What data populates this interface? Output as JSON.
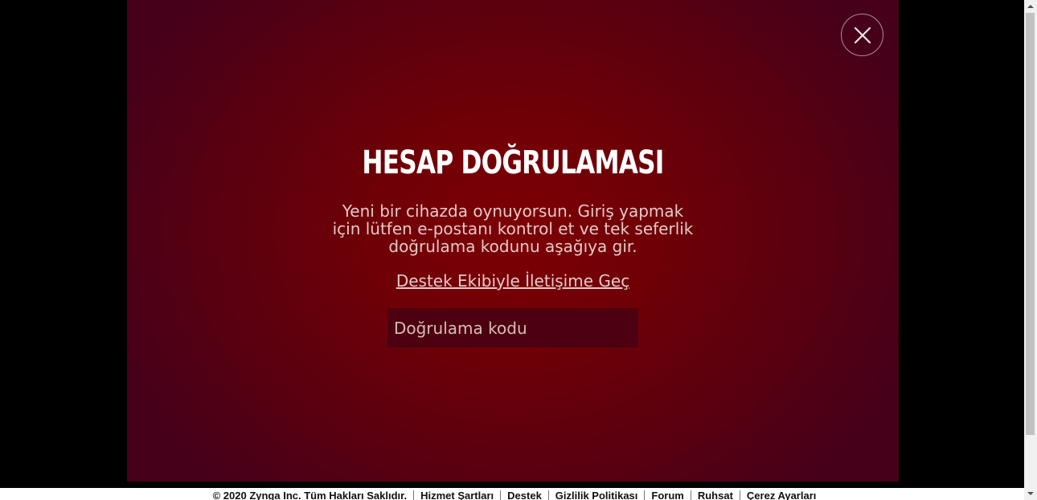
{
  "modal": {
    "title": "HESAP DOĞRULAMASI",
    "description": "Yeni bir cihazda oynuyorsun. Giriş yapmak için lütfen e-postanı kontrol et ve tek seferlik doğrulama kodunu aşağıya gir.",
    "support_link": "Destek Ekibiyle İletişime Geç",
    "code_input": {
      "placeholder": "Doğrulama kodu",
      "value": ""
    },
    "close_icon": "close-icon"
  },
  "footer": {
    "copyright": "© 2020 Zynga Inc. Tüm Hakları Saklıdır.",
    "links": [
      "Hizmet Şartları",
      "Destek",
      "Gizlilik Politikası",
      "Forum",
      "Ruhsat",
      "Çerez Ayarları"
    ]
  },
  "colors": {
    "modal_center": "#7c0005",
    "modal_edge": "#470019",
    "input_bg": "#4d0010",
    "text_light": "#e5c9c9"
  }
}
